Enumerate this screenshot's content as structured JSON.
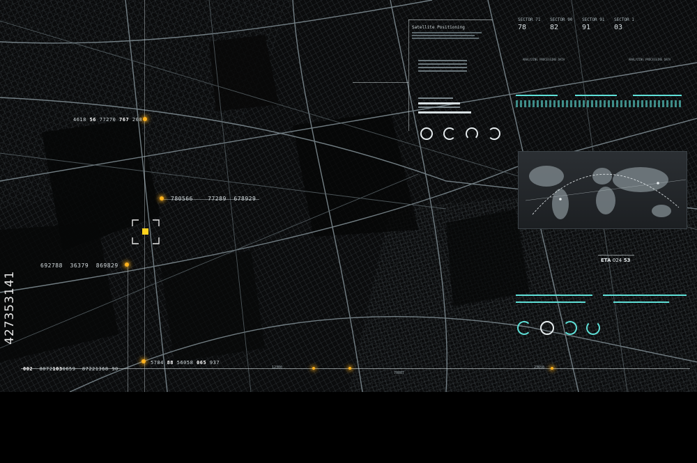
{
  "overlay": {
    "coord_rows": [
      {
        "a": "4618",
        "b": "56",
        "c": "77270",
        "d": "767",
        "e": "208"
      },
      {
        "a": "780566",
        "b": "",
        "c": "77289",
        "d": "",
        "e": "678929"
      },
      {
        "a": "692788",
        "b": "",
        "c": "36379",
        "d": "",
        "e": "869829"
      }
    ],
    "bottom_bar": {
      "start": "002",
      "seq1": "8072",
      "seq1_bold": "103",
      "seq1_tail": "0659",
      "seq2": "87221368",
      "seq2_tail": "90",
      "mid1": "5784",
      "mid1_b": "88",
      "mid1_c": "56058",
      "mid1_d": "065",
      "mid1_e": "937",
      "mid2": "12300",
      "mid3": "70087",
      "mid4": "23650"
    },
    "sectors": [
      {
        "label": "SECTOR 71",
        "value": "78"
      },
      {
        "label": "SECTOR 90",
        "value": "82"
      },
      {
        "label": "SECTOR 91",
        "value": "91"
      },
      {
        "label": "SECTOR 1",
        "value": "03"
      }
    ],
    "satellite_title": "Satellite Positioning",
    "analyzing_label": "ANALYZING PROCESSING DATA",
    "eta": {
      "label": "ETA",
      "a": "024",
      "b": "53"
    },
    "watermark": "427353141",
    "accent": "#ffb21e",
    "teal": "#5fe0d8",
    "icons": [
      "target-reticle-icon",
      "world-map-icon",
      "ring-gauge-icon"
    ]
  }
}
